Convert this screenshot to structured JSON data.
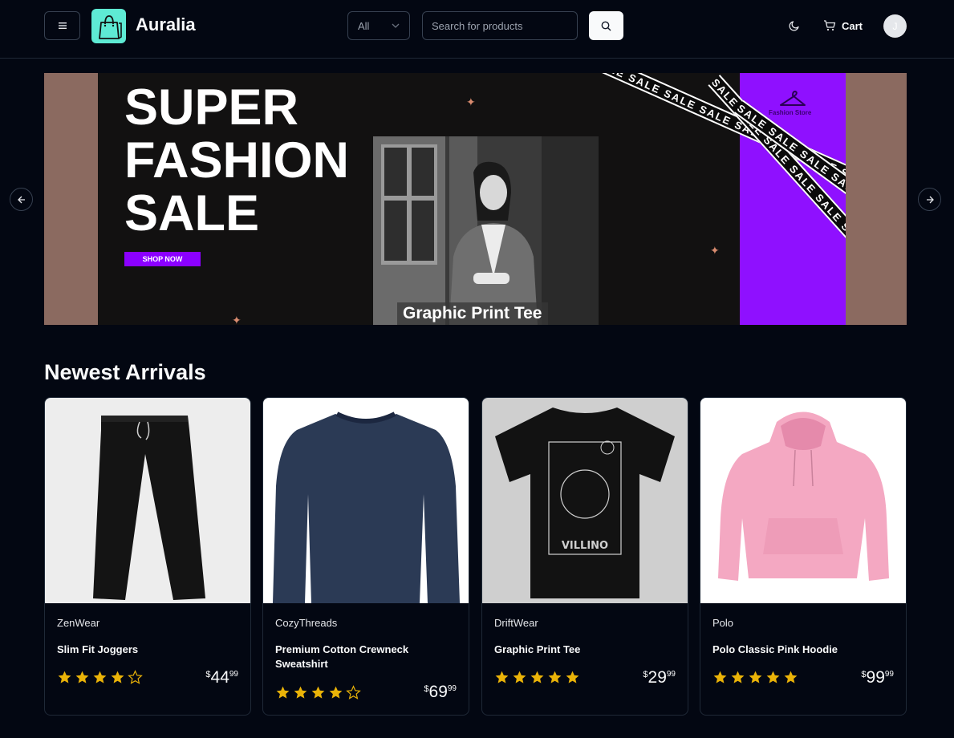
{
  "header": {
    "brand": "Auralia",
    "category_select": "All",
    "search_placeholder": "Search for products",
    "cart_label": "Cart",
    "avatar_initial": "J",
    "icons": [
      "menu-icon",
      "shopping-bag-icon",
      "chevron-down-icon",
      "search-icon",
      "moon-icon",
      "cart-icon"
    ]
  },
  "hero": {
    "headline": "SUPER\nFASHION\nSALE",
    "cta": "SHOP NOW",
    "store_label": "Fashion Store",
    "tape_text": "SALE SALE SALE SALE SALE SALE SALE SALE",
    "caption": "Graphic Print Tee",
    "accent_color": "#8b00ff"
  },
  "section": {
    "title": "Newest Arrivals"
  },
  "products": [
    {
      "brand": "ZenWear",
      "name": "Slim Fit Joggers",
      "rating": 4,
      "currency": "$",
      "price_whole": "44",
      "price_cents": "99"
    },
    {
      "brand": "CozyThreads",
      "name": "Premium Cotton Crewneck Sweatshirt",
      "rating": 4,
      "currency": "$",
      "price_whole": "69",
      "price_cents": "99"
    },
    {
      "brand": "DriftWear",
      "name": "Graphic Print Tee",
      "rating": 5,
      "currency": "$",
      "price_whole": "29",
      "price_cents": "99"
    },
    {
      "brand": "Polo",
      "name": "Polo Classic Pink Hoodie",
      "rating": 5,
      "currency": "$",
      "price_whole": "99",
      "price_cents": "99"
    }
  ],
  "colors": {
    "background": "#030712",
    "star": "#eab308",
    "purple": "#8f10ff"
  }
}
